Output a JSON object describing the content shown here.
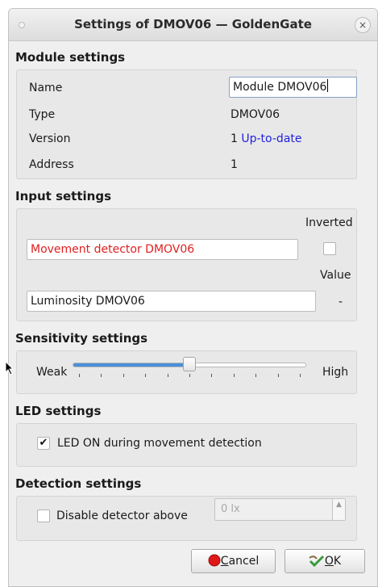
{
  "window": {
    "title": "Settings of DMOV06 — GoldenGate",
    "close_glyph": "×"
  },
  "module": {
    "section_title": "Module settings",
    "name_label": "Name",
    "name_value": "Module DMOV06",
    "type_label": "Type",
    "type_value": "DMOV06",
    "version_label": "Version",
    "version_number": "1",
    "version_status": "Up-to-date",
    "address_label": "Address",
    "address_value": "1"
  },
  "input": {
    "section_title": "Input settings",
    "inverted_label": "Inverted",
    "movement_value": "Movement detector DMOV06",
    "movement_color": "#e02020",
    "inverted_checked": false,
    "value_label": "Value",
    "luminosity_value": "Luminosity DMOV06",
    "luminosity_reading": "-"
  },
  "sensitivity": {
    "section_title": "Sensitivity settings",
    "min_label": "Weak",
    "max_label": "High",
    "level_fraction": 0.5,
    "tick_count": 11
  },
  "led": {
    "section_title": "LED settings",
    "checkbox_label": "LED ON during movement detection",
    "checked": true,
    "check_glyph": "✔"
  },
  "detection": {
    "section_title": "Detection settings",
    "checkbox_label": "Disable detector above",
    "checked": false,
    "threshold_value": "0 lx"
  },
  "buttons": {
    "cancel_prefix": "",
    "cancel_accel": "C",
    "cancel_rest": "ancel",
    "ok_accel": "O",
    "ok_rest": "K"
  },
  "colors": {
    "accent": "#4a90d9",
    "link": "#2222dd",
    "cancel_icon": "#e01818",
    "ok_icon": "#3a9a3a"
  }
}
